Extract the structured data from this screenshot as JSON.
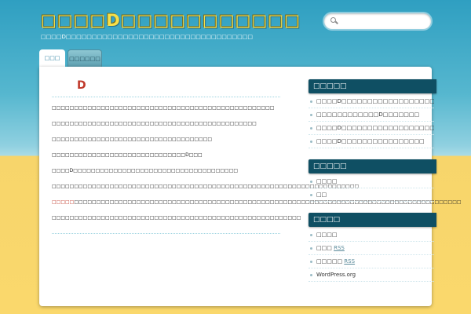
{
  "header": {
    "title": "□□□□D□□□□□□□□□□□",
    "description": "□□□□D□□□□□□□□□□□□□□□□□□□□□□□□□□□□□□□□□□□□"
  },
  "search": {
    "placeholder": ""
  },
  "tabs": [
    {
      "label": "□□□",
      "active": true
    },
    {
      "label": "□□□□□□",
      "active": false
    }
  ],
  "post": {
    "title": "D",
    "paragraphs": [
      "□□□□□□□□□□□□□□□□□□□□□□□□□□□□□□□□□□□□□□□□□□□□□□□□□□",
      "□□□□□□□□□□□□□□□□□□□□□□□□□□□□□□□□□□□□□□□□□□□□□□",
      "□□□□□□□□□□□□□□□□□□□□□□□□□□□□□□□□□□□□",
      "□□□□□□□□□□□□□□□□□□□□□□□□□□□□□□D□□□",
      "□□□□D□□□□□□□□□□□□□□□□□□□□□□□□□□□□□□□□□□□□□",
      "□□□□□□□□□□□□□□□□□□□□□□□□□□□□□□□□□□□□□□□□□□□□□□□□□□□□□□□□□□□□□□□□□□□□□",
      "□□□□□□□□□□□□□□□□□□□□□□□□□□□□□□□□□□□□□□□□□□□□□□□□□□□□□□□□□□□□□□□□□□□□□□□□□□□□□□□□□□□□□□□",
      "□□□□□□□□□□□□□□□□□□□□□□□□□□□□□□□□□□□□□□□□□□□□□□□□□□□□□□□□"
    ],
    "highlight": "□□□□□"
  },
  "sidebar": {
    "recent": {
      "title": "□□□□□",
      "items": [
        "□□□□D□□□□□□□□□□□□□□□□□□□□□□",
        "□□□□□□□□□□□□D□□□□□□□",
        "□□□□D□□□□□□□□□□□□□□□□□□",
        "□□□□D□□□□□□□□□□□□□□□□"
      ]
    },
    "categories": {
      "title": "□□□□□",
      "items": [
        "□□□□",
        "□□"
      ]
    },
    "meta": {
      "title": "□□□□",
      "items": [
        {
          "prefix": "□□□□",
          "suffix": ""
        },
        {
          "prefix": "□□□ ",
          "suffix": "RSS"
        },
        {
          "prefix": "□□□□□ ",
          "suffix": "RSS"
        },
        {
          "prefix": "WordPress.org",
          "suffix": ""
        }
      ]
    }
  },
  "colors": {
    "accent": "#0f4f63",
    "title": "#f6df4a",
    "highlight": "#c0392b",
    "sky": "#2f9fc1",
    "sand": "#fad86c"
  }
}
